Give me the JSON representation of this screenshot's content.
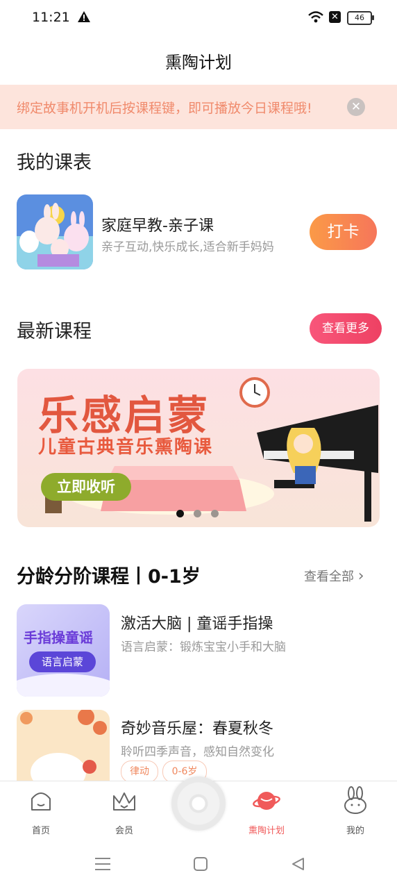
{
  "status_bar": {
    "time": "11:21",
    "battery": "46"
  },
  "header": {
    "title": "熏陶计划"
  },
  "notice": {
    "text": "绑定故事机开机后按课程键，即可播放今日课程哦!",
    "close_icon": "close-icon"
  },
  "my_schedule": {
    "title": "我的课表",
    "course": {
      "name": "家庭早教-亲子课",
      "desc": "亲子互动,快乐成长,适合新手妈妈",
      "button": "打卡"
    }
  },
  "latest": {
    "title": "最新课程",
    "more_button": "查看更多",
    "banner": {
      "line1": "乐感启蒙",
      "line2": "儿童古典音乐熏陶课",
      "cta": "立即收听"
    }
  },
  "age_courses": {
    "title": "分龄分阶课程丨0-1岁",
    "see_all": "查看全部",
    "items": [
      {
        "thumb_title": "手指操童谣",
        "thumb_tag": "语言启蒙",
        "title": "激活大脑 | 童谣手指操",
        "desc": "语言启蒙：锻炼宝宝小手和大脑"
      },
      {
        "title": "奇妙音乐屋：春夏秋冬",
        "desc": "聆听四季声音，感知自然变化",
        "tags": [
          "律动",
          "0-6岁"
        ]
      }
    ]
  },
  "bottom_nav": {
    "items": [
      {
        "label": "首页",
        "icon": "home-icon"
      },
      {
        "label": "会员",
        "icon": "crown-icon"
      },
      {
        "label": "熏陶计划",
        "icon": "planet-icon",
        "active": true
      },
      {
        "label": "我的",
        "icon": "rabbit-icon"
      }
    ],
    "active_color": "#f05a5a"
  },
  "colors": {
    "accent": "#f6765a",
    "notice_bg": "#fde4dc",
    "pink_button": "#ee4163"
  }
}
